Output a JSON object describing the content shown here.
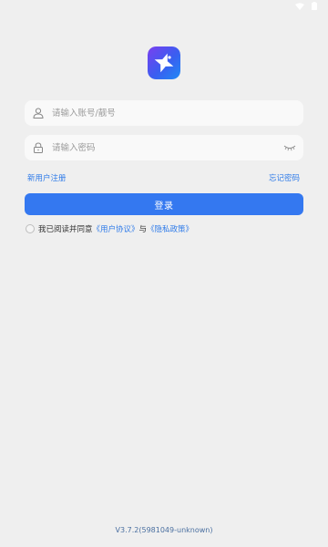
{
  "icons": {
    "wifi": "wifi-icon",
    "battery": "battery-icon",
    "logo": "app-logo",
    "user": "user-icon",
    "lock": "lock-icon",
    "eye": "eye-closed-icon"
  },
  "colors": {
    "background": "#efefef",
    "primary": "#3478f0",
    "link": "#2f7be9"
  },
  "form": {
    "account_placeholder": "请输入账号/靓号",
    "account_value": "",
    "password_placeholder": "请输入密码",
    "password_value": ""
  },
  "links": {
    "register": "新用户注册",
    "forgot": "忘记密码"
  },
  "login_button": "登录",
  "agreement": {
    "checked": false,
    "prefix": "我已阅读并同意",
    "user_agreement": "《用户协议》",
    "connector": "与",
    "privacy_policy": "《隐私政策》"
  },
  "version": "V3.7.2(5981049-unknown)"
}
